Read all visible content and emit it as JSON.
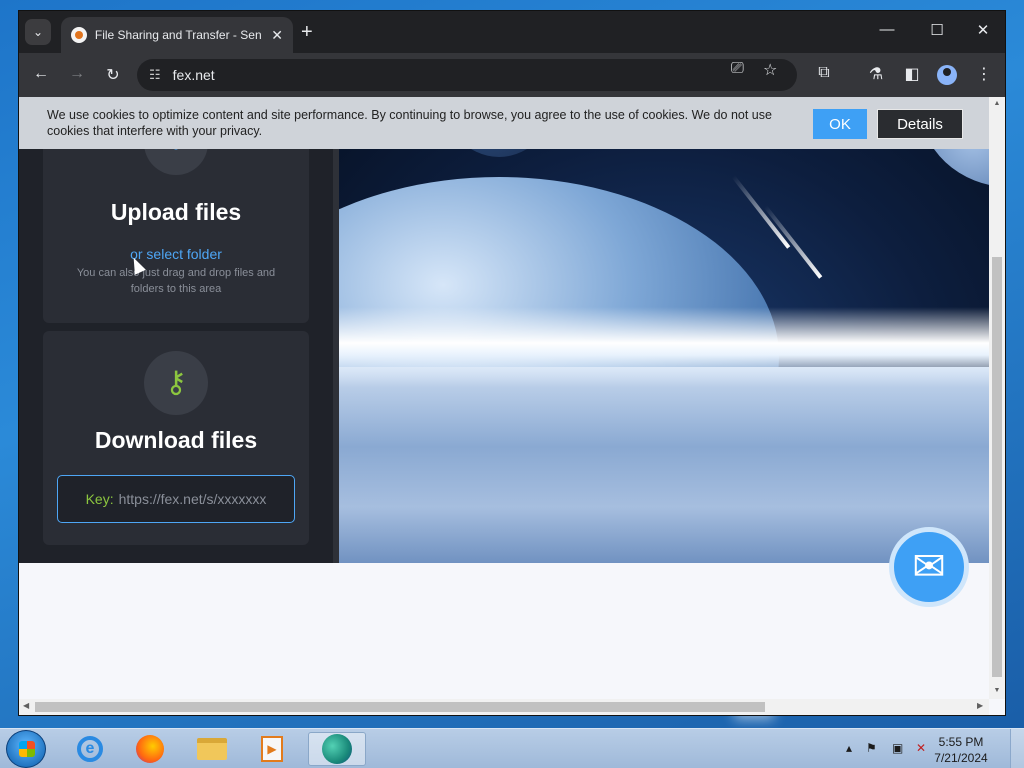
{
  "browser": {
    "tab_title": "File Sharing and Transfer - Sen",
    "tab_close": "✕",
    "new_tab": "+",
    "url": "fex.net"
  },
  "cookie_banner": {
    "text": "We use cookies to optimize content and site performance. By continuing to browse, you agree to the use of cookies. We do not use cookies that interfere with your privacy.",
    "ok_label": "OK",
    "details_label": "Details"
  },
  "upload_card": {
    "title": "Upload files",
    "select_folder": "or select folder",
    "hint": "You can also just drag and drop files and folders to this area"
  },
  "download_card": {
    "title": "Download files",
    "key_label": "Key:",
    "key_placeholder": "https://fex.net/s/xxxxxxx"
  },
  "taskbar": {
    "time": "5:55 PM",
    "date": "7/21/2024"
  },
  "icons": {
    "accent": "#3ea0f5",
    "key_color": "#8cc63f"
  }
}
